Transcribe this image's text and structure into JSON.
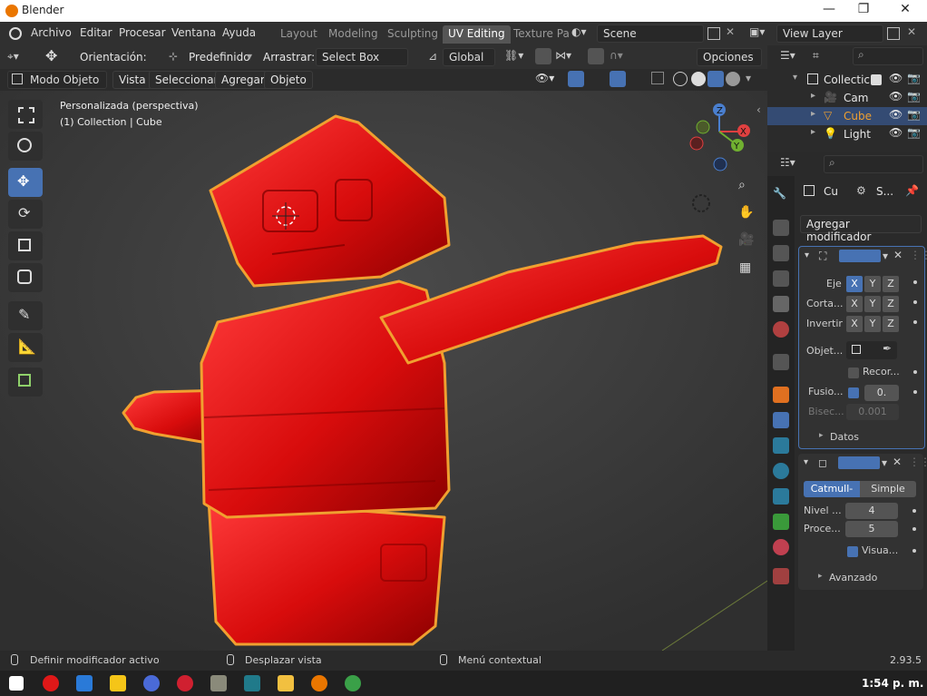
{
  "window": {
    "title": "Blender",
    "icon": "blender-icon"
  },
  "menu": [
    "Archivo",
    "Editar",
    "Procesar",
    "Ventana",
    "Ayuda"
  ],
  "workspace_tabs": [
    {
      "label": "Layout",
      "active": false
    },
    {
      "label": "Modeling",
      "active": false
    },
    {
      "label": "Sculpting",
      "active": false
    },
    {
      "label": "UV Editing",
      "active": true
    },
    {
      "label": "Texture Pa",
      "active": false
    }
  ],
  "scene": {
    "label": "Scene"
  },
  "view_layer": {
    "label": "View Layer"
  },
  "tool_header": {
    "orientation_label": "Orientación:",
    "orientation_value": "Predefinido",
    "drag_label": "Arrastrar:",
    "drag_value": "Select Box",
    "transform_value": "Global",
    "options_label": "Opciones"
  },
  "viewport_header": {
    "mode": "Modo Objeto",
    "menus": [
      "Vista",
      "Seleccionar",
      "Agregar",
      "Objeto"
    ]
  },
  "viewport": {
    "view_name": "Personalizada (perspectiva)",
    "collection_info": "(1) Collection | Cube",
    "gizmo_axes": [
      "X",
      "Y",
      "Z"
    ]
  },
  "outliner": {
    "items": [
      {
        "label": "Collectic",
        "selected": false
      },
      {
        "label": "Cam",
        "selected": false
      },
      {
        "label": "Cube",
        "selected": true
      },
      {
        "label": "Light",
        "selected": false
      }
    ]
  },
  "properties": {
    "object_short": "Cu",
    "modifier_short": "S...",
    "add_modifier": "Agregar modificador",
    "mirror": {
      "axis_label": "Eje",
      "bisect_label": "Corta...",
      "flip_label": "Invertir",
      "object_label": "Objet...",
      "clip_label": "Recor...",
      "merge_label": "Fusio...",
      "merge_value": "0.",
      "bisect_dist_label": "Bisec...",
      "bisect_dist_value": "0.001",
      "data_label": "Datos",
      "axes": [
        "X",
        "Y",
        "Z"
      ]
    },
    "subsurf": {
      "type_catmull": "Catmull-C...",
      "type_simple": "Simple",
      "levels_label": "Nivel ...",
      "levels_value": "4",
      "render_label": "Proce...",
      "render_value": "5",
      "optimal_label": "Visua...",
      "advanced_label": "Avanzado"
    }
  },
  "statusbar": {
    "left": "Definir modificador activo",
    "middle": "Desplazar vista",
    "right": "Menú contextual",
    "version": "2.93.5"
  },
  "taskbar": {
    "clock": "1:54 p. m."
  },
  "colors": {
    "accent": "#4772b3",
    "object": "#e01010",
    "outline": "#f0a030"
  }
}
